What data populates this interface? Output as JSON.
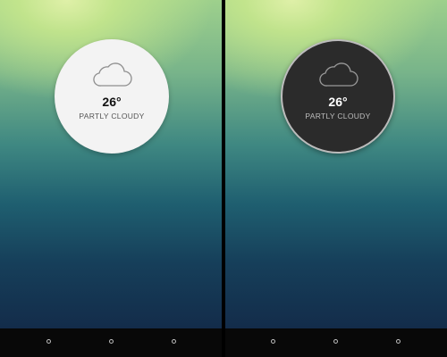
{
  "screens": [
    {
      "theme": "light",
      "weather": {
        "icon": "cloud-icon",
        "temperature": "26°",
        "condition": "PARTLY CLOUDY"
      },
      "nav": [
        "back-icon",
        "home-icon",
        "recents-icon"
      ]
    },
    {
      "theme": "dark",
      "weather": {
        "icon": "cloud-icon",
        "temperature": "26°",
        "condition": "PARTLY CLOUDY"
      },
      "nav": [
        "back-icon",
        "home-icon",
        "recents-icon"
      ]
    }
  ],
  "colors": {
    "light_widget": "#f3f3f3",
    "dark_widget": "#2b2b2b",
    "navbar": "#080808"
  }
}
